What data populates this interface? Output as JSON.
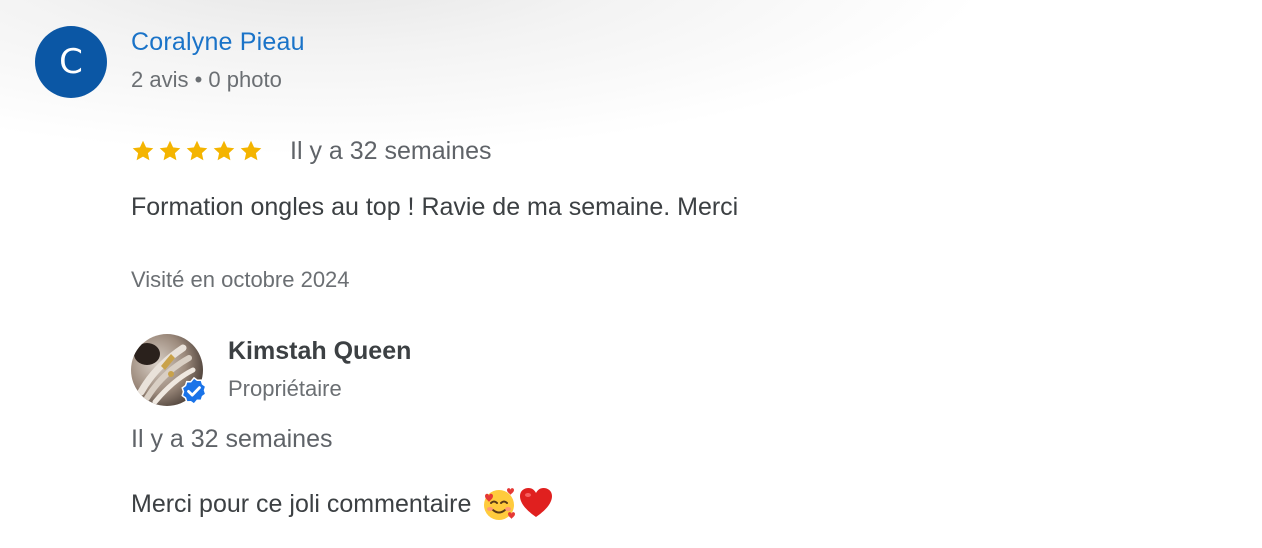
{
  "review": {
    "author": {
      "initial": "C",
      "name": "Coralyne Pieau",
      "meta": "2 avis • 0 photo",
      "avatar_color": "#0b57a5",
      "name_color": "#1a73c8"
    },
    "rating": 5,
    "rating_max": 5,
    "star_color": "#f4b400",
    "star_icon": "star-icon",
    "date": "Il y a 32 semaines",
    "text": "Formation ongles au top ! Ravie de ma semaine. Merci",
    "visit": "Visité en octobre 2024"
  },
  "reply": {
    "owner_name": "Kimstah Queen",
    "owner_role": "Propriétaire",
    "verified_icon": "verified-badge-icon",
    "verified_color": "#1a73e8",
    "date": "Il y a 32 semaines",
    "text": "Merci pour ce joli commentaire",
    "emojis": [
      "smiling-face-with-hearts-emoji",
      "red-heart-emoji"
    ]
  }
}
